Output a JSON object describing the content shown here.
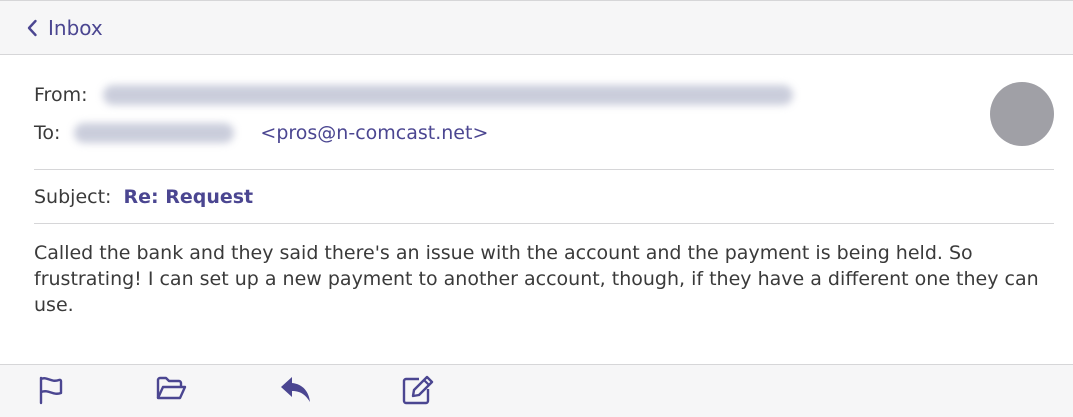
{
  "nav": {
    "back_label": "Inbox",
    "back_icon": "chevron-left-icon"
  },
  "header": {
    "from_label": "From:",
    "to_label": "To:",
    "to_address": "<pros@n-comcast.net>",
    "avatar_color": "#a0a0a6"
  },
  "subject": {
    "label": "Subject:",
    "value": "Re: Request"
  },
  "body": {
    "text": "Called the bank and they said there's an issue with the account and the payment is being held. So frustrating! I can set up a new payment to another account, though, if they have a different one they can use."
  },
  "toolbar": {
    "icons": [
      "flag-icon",
      "folder-icon",
      "reply-icon",
      "compose-icon"
    ]
  },
  "colors": {
    "accent": "#4b4691",
    "text": "#3a3a3a",
    "divider": "#d6d6d8",
    "bar_bg": "#f6f6f7"
  }
}
